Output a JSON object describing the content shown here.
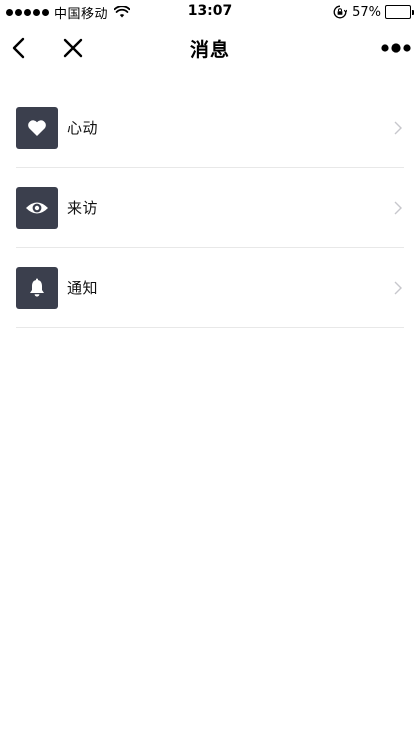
{
  "status_bar": {
    "carrier": "中国移动",
    "time": "13:07",
    "battery": "57%",
    "battery_level": 0.57
  },
  "nav": {
    "title": "消息",
    "back_icon": "chevron-left-icon",
    "close_icon": "close-icon",
    "more_icon": "more-dots-icon"
  },
  "list": {
    "items": [
      {
        "label": "心动",
        "icon": "heart-icon"
      },
      {
        "label": "来访",
        "icon": "eye-icon"
      },
      {
        "label": "通知",
        "icon": "bell-icon"
      }
    ]
  },
  "colors": {
    "icon_tile": "#3b3f4d",
    "divider": "#e8e8e8",
    "chevron": "#c7c7cc"
  }
}
